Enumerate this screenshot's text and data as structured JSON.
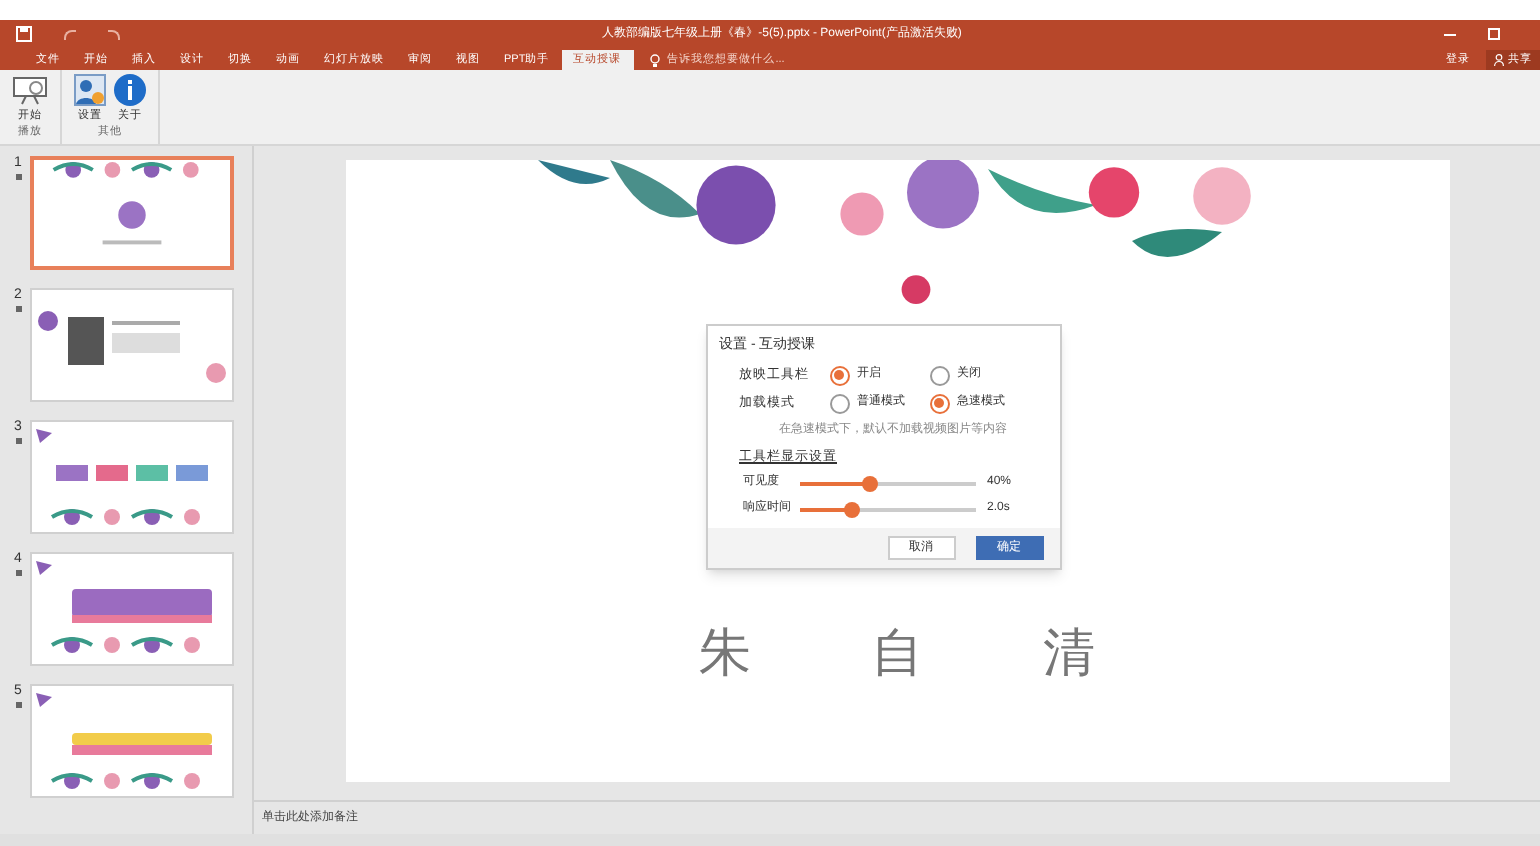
{
  "window": {
    "title": "人教部编版七年级上册《春》-5(5).pptx - PowerPoint(产品激活失败)",
    "account": [
      "登录",
      "共享"
    ]
  },
  "tabs": [
    {
      "label": "文件",
      "selected": false
    },
    {
      "label": "开始",
      "selected": false
    },
    {
      "label": "插入",
      "selected": false
    },
    {
      "label": "设计",
      "selected": false
    },
    {
      "label": "切换",
      "selected": false
    },
    {
      "label": "动画",
      "selected": false
    },
    {
      "label": "幻灯片放映",
      "selected": false
    },
    {
      "label": "审阅",
      "selected": false
    },
    {
      "label": "视图",
      "selected": false
    },
    {
      "label": "PPT助手",
      "selected": false
    },
    {
      "label": "互动授课",
      "selected": true
    }
  ],
  "tell_me": {
    "placeholder": "告诉我您想要做什么..."
  },
  "ribbon_groups": [
    {
      "label": "播放",
      "buttons": [
        {
          "label": "开始",
          "kind": "screen"
        }
      ]
    },
    {
      "label": "其他",
      "buttons": [
        {
          "label": "设置",
          "kind": "settings"
        },
        {
          "label": "关于",
          "kind": "info"
        }
      ]
    }
  ],
  "slides": [
    {
      "number": "1",
      "selected": true,
      "kind": "title"
    },
    {
      "number": "2",
      "selected": false,
      "kind": "portrait"
    },
    {
      "number": "3",
      "selected": false,
      "kind": "tags"
    },
    {
      "number": "4",
      "selected": false,
      "kind": "purple"
    },
    {
      "number": "5",
      "selected": false,
      "kind": "yellow"
    }
  ],
  "slide": {
    "author": [
      "朱",
      "自",
      "清"
    ]
  },
  "dialog": {
    "title": "设置 - 互动授课",
    "options": [
      {
        "label": "放映工具栏",
        "choices": [
          {
            "label": "开启",
            "selected": true
          },
          {
            "label": "关闭",
            "selected": false
          }
        ]
      },
      {
        "label": "加载模式",
        "choices": [
          {
            "label": "普通模式",
            "selected": false
          },
          {
            "label": "急速模式",
            "selected": true
          }
        ]
      }
    ],
    "hint": "在急速模式下，默认不加载视频图片等内容",
    "section": "工具栏显示设置",
    "sliders": [
      {
        "label": "可见度",
        "level": 0.4,
        "reading": "40%"
      },
      {
        "label": "响应时间",
        "level": 0.3,
        "reading": "2.0s"
      }
    ],
    "buttons": [
      "取消",
      "确定"
    ]
  },
  "notes": {
    "placeholder": "单击此处添加备注"
  }
}
